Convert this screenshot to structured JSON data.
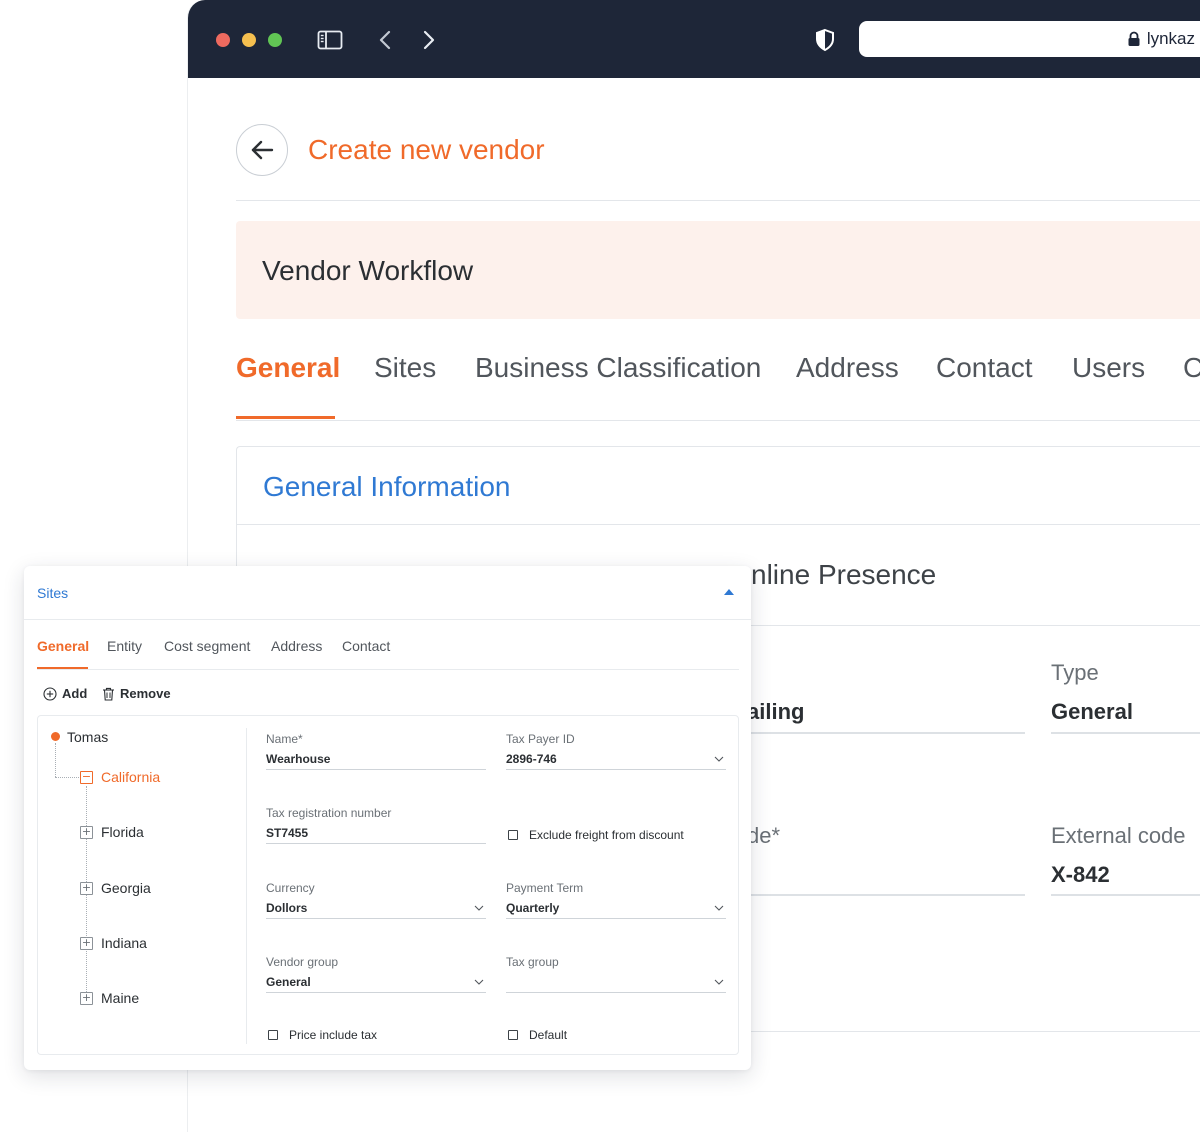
{
  "browser": {
    "url": "lynkaz"
  },
  "page": {
    "title": "Create new vendor",
    "workflow_title": "Vendor Workflow",
    "tabs": [
      "General",
      "Sites",
      "Business Classification",
      "Address",
      "Contact",
      "Users",
      "C"
    ],
    "active_tab": "General",
    "section_title": "General Information",
    "subsection_title": "nline Presence",
    "fields": {
      "partial_value": "ailing",
      "type_label": "Type",
      "type_value": "General",
      "code_label_partial": "de*",
      "external_code_label": "External code",
      "external_code_value": "X-842"
    }
  },
  "sites_panel": {
    "title": "Sites",
    "tabs": [
      "General",
      "Entity",
      "Cost segment",
      "Address",
      "Contact"
    ],
    "active_tab": "General",
    "actions": {
      "add": "Add",
      "remove": "Remove"
    },
    "tree": {
      "root": "Tomas",
      "selected": "California",
      "children": [
        "California",
        "Florida",
        "Georgia",
        "Indiana",
        "Maine"
      ]
    },
    "form": {
      "name_label": "Name*",
      "name_value": "Wearhouse",
      "tax_payer_label": "Tax Payer ID",
      "tax_payer_value": "2896-746",
      "tax_reg_label": "Tax registration number",
      "tax_reg_value": "ST7455",
      "exclude_freight_label": "Exclude freight from discount",
      "currency_label": "Currency",
      "currency_value": "Dollors",
      "payment_term_label": "Payment Term",
      "payment_term_value": "Quarterly",
      "vendor_group_label": "Vendor group",
      "vendor_group_value": "General",
      "tax_group_label": "Tax group",
      "tax_group_value": "",
      "price_include_tax_label": "Price include tax",
      "default_label": "Default"
    }
  },
  "colors": {
    "accent": "#f06a2a",
    "link_blue": "#2f79d3",
    "titlebar": "#1e2638",
    "workflow_bg": "#fdf1ec"
  }
}
